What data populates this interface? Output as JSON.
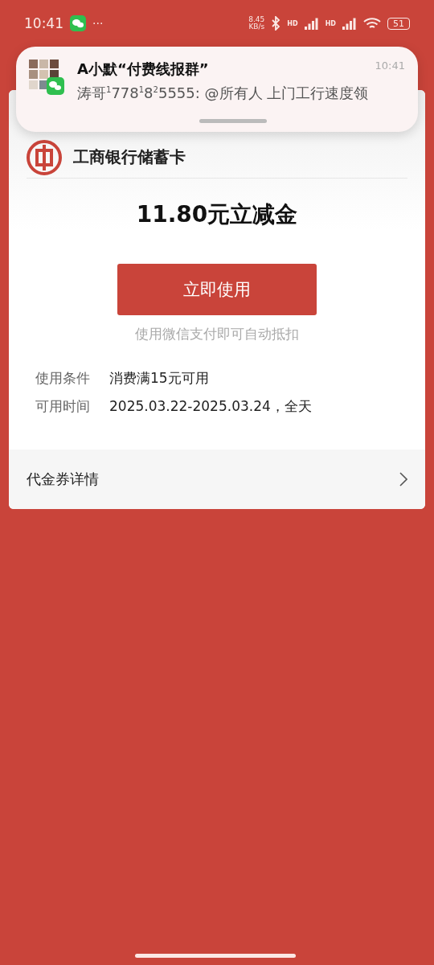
{
  "status_bar": {
    "time": "10:41",
    "more": "···",
    "speed_value": "8.45",
    "speed_unit": "KB/s",
    "signal_labels": [
      "HD",
      "HD"
    ],
    "battery": "51"
  },
  "notification": {
    "title": "A小默“付费线报群”",
    "time": "10:41",
    "message": "涛哥$^{1}$778$^{1}$8$^{2}$5555: @所有人 上门工行速度领"
  },
  "card": {
    "bank_name": "工商银行储蓄卡",
    "amount_title": "11.80元立减金",
    "use_button": "立即使用",
    "hint": "使用微信支付即可自动抵扣",
    "details": [
      {
        "label": "使用条件",
        "value": "消费满15元可用"
      },
      {
        "label": "可用时间",
        "value": "2025.03.22-2025.03.24，全天"
      }
    ],
    "detail_link": "代金券详情"
  }
}
